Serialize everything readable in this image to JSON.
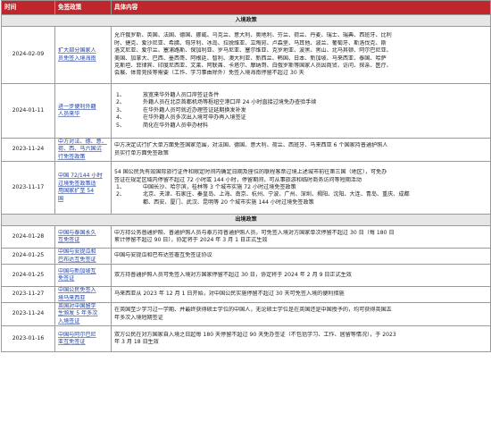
{
  "header": {
    "time": "时间",
    "policy": "免签政策",
    "content": "具体内容"
  },
  "sections": [
    {
      "title": "入境政策",
      "rows": [
        {
          "date": "2024-02-09",
          "policy": [
            "扩大部分国家人",
            "员免签入境海南"
          ],
          "lines": [
            "允许俄罗斯、英国、法国、德国、挪威、乌克兰、意大利、奥地利、芬兰、荷兰、丹麦、瑞士、瑞典、西班牙、比利",
            "时、捷克、爱沙尼亚、希腊、匈牙利、冰岛、拉脱维亚、立陶宛、卢森堡、马耳他、波兰、葡萄牙、斯洛伐克、斯",
            "洛文尼亚、爱尔兰、塞浦路斯、保加利亚、罗马尼亚、塞尔维亚、克罗地亚、波黑、黑山、北马其顿、阿尔巴尼亚、",
            "美国、加拿大、巴西、墨西哥、阿根廷、智利、澳大利亚、新西兰、韩国、日本、新加坡、马来西亚、泰国、哈萨",
            "克斯坦、菲律宾、印度尼西亚、文莱、阿联酋、卡塔尔、摩纳哥、白俄罗斯等国家人员因商贸、访问、探亲、医疗、",
            "会展、体育竞技等需要（工作、学习事由除外）免签入境海南停留不超过 30 天"
          ]
        },
        {
          "date": "2024-01-11",
          "policy": [
            "进一步便利外籍",
            "人员来华"
          ],
          "items": [
            {
              "num": "1、",
              "text": "放宽来华外籍人员口岸签证条件"
            },
            {
              "num": "2、",
              "text": "外籍人员在北京首都机场等枢纽空港口岸 24 小时直接过境免办查验手续"
            },
            {
              "num": "3、",
              "text": "在华外籍人员可就近办理签证延期换发补发"
            },
            {
              "num": "4、",
              "text": "在华外籍人员多次出入境可申办再入境签证"
            },
            {
              "num": "5、",
              "text": "简化在华外籍人员申办材料"
            }
          ]
        },
        {
          "date": "2023-11-24",
          "policy": [
            "中方对法、德、意、",
            "荷、西、马六国试",
            "行免签政策"
          ],
          "lines": [
            "中方决定试行扩大单方面免签国家范围，对法国、德国、意大利、荷兰、西班牙、马来西亚 6 个国家持普通护照人",
            "员实行单方面免签政策"
          ]
        },
        {
          "date": "2023-11-17",
          "policy": [
            "中国 72/144 小时",
            "过境免签政策适",
            "用国家扩至 54",
            "国"
          ],
          "lines": [
            "54 国公民凭有效国际旅行证件和限定时间内确定日期及座位的联程客票过境上述城市前往第三国（地区），可免办",
            "签证在规定区域内停留不超过 72 小时或 144 小时，停留期间，可从事旅游和临时商务访问等短期活动"
          ],
          "items": [
            {
              "num": "1、",
              "text": "中国长沙、哈尔滨，桂林等 3 个城市实施 72 小时过境免签政策"
            },
            {
              "num": "2、",
              "text": "北京、天津、石家庄、秦皇岛、上海、南京、杭州、宁波、广州、深圳、揭阳、沈阳、大连、青岛、重庆、成都"
            },
            {
              "num": "",
              "text": "都、西安、厦门、武汉、昆明等 20 个城市实施 144 小时过境免签政策"
            }
          ]
        }
      ]
    },
    {
      "title": "出境政策",
      "rows": [
        {
          "date": "2024-01-28",
          "policy": [
            "中国与泰国永久",
            "互免签证"
          ],
          "lines": [
            "中方持公务普通护照、普通护照人员与泰方持普通护照人员，可免签入境对方国家单次停留不超过 30 日（每 180 日",
            "累计停留不超过 90 日），协定将于 2024 年 3 月 1 日正式生效"
          ]
        },
        {
          "date": "2024-01-25",
          "policy": [
            "中国与安提瓜和",
            "巴布达互免签证"
          ],
          "lines": [
            "中国与安提瓜和巴布达签署互免签证协议"
          ]
        },
        {
          "date": "2024-01-25",
          "policy": [
            "中国与新加坡互",
            "免签证"
          ],
          "lines": [
            "双方持普通护照人员可免签入境对方国家停留不超过 30 日，协定将于 2024 年 2 月 9 日正式生效"
          ]
        },
        {
          "date": "2023-11-27",
          "policy": [
            "中国公民免签入",
            "境马来西亚"
          ],
          "lines": [
            "马来西亚从 2023 年 12 月 1 日开始，对中国公民实施停留不超过 30 天可免签入境的便利措施"
          ]
        },
        {
          "date": "2023-11-24",
          "policy": [
            "英国对中国留学",
            "生颁发 5 年多次",
            "入境签证"
          ],
          "lines": [
            "在英国至少学习过一学期、并最终获得硕士学位的中国人，无论硕士学位是在英国还是中国授予的，均可获得英国五",
            "年多次入境短期签证"
          ]
        },
        {
          "date": "2023-01-16",
          "policy": [
            "中国与阿尔巴尼",
            "亚互免签证"
          ],
          "lines": [
            "双方公民在对方国家自入境之日起每 180 天停留不超过 90 天免办签证（不包括学习、工作、居留等情况），于 2023",
            "年 3 月 18 日生效"
          ]
        }
      ]
    }
  ]
}
